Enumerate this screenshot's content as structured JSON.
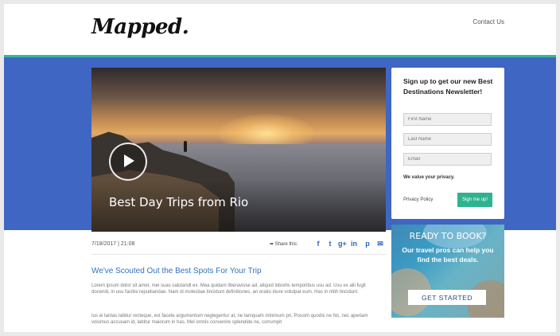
{
  "header": {
    "logo": "Mapped.",
    "contact_link": "Contact Us"
  },
  "hero": {
    "title": "Best Day Trips from Rio",
    "play_icon": "play-icon"
  },
  "meta": {
    "date": "7/18/2017 | 21:08",
    "share_label": "Share this:",
    "social_icons": [
      {
        "name": "facebook-icon",
        "glyph": "f"
      },
      {
        "name": "twitter-icon",
        "glyph": "t"
      },
      {
        "name": "google-plus-icon",
        "glyph": "g+"
      },
      {
        "name": "linkedin-icon",
        "glyph": "in"
      },
      {
        "name": "pinterest-icon",
        "glyph": "p"
      },
      {
        "name": "email-icon",
        "glyph": "✉"
      }
    ]
  },
  "article": {
    "title": "We've Scouted Out the Best Spots For Your Trip",
    "paragraph1": "Lorem ipsum dolor sit amet, mei suas salutandi ex. Mea quidam liberavisse ad, aliquid lobortis temporibus usu ad. Usu ex alii fugit docendi, in usu facilisi repudiandae. Nam id molestiae tincidunt definitiones, an oratio iriure volutpat eum. Has in nibh tincidunt.",
    "paragraph2": "Ius ei tantas labitur recteque, est facete argumentum neglegentur at, ne tamquam minimum pri. Possim quodsi ne his, nec aperiam volumus accusam id, labitur maiorum in has. Mel omnis convenire splendide ne, corrumpit"
  },
  "newsletter": {
    "title": "Sign up to get our new Best Destinations Newsletter!",
    "first_name_placeholder": "First Name",
    "last_name_placeholder": "Last Name",
    "email_placeholder": "Email",
    "privacy_note": "We value your privacy.",
    "privacy_policy": "Privacy Policy",
    "signup_label": "Sign me up!"
  },
  "ad": {
    "title": "READY TO BOOK?",
    "subtitle": "Our travel pros can help you find the best deals.",
    "cta": "GET STARTED"
  },
  "colors": {
    "band": "#3e66c2",
    "accent": "#35b99a",
    "link": "#2f72c4",
    "button": "#2fb38f"
  }
}
